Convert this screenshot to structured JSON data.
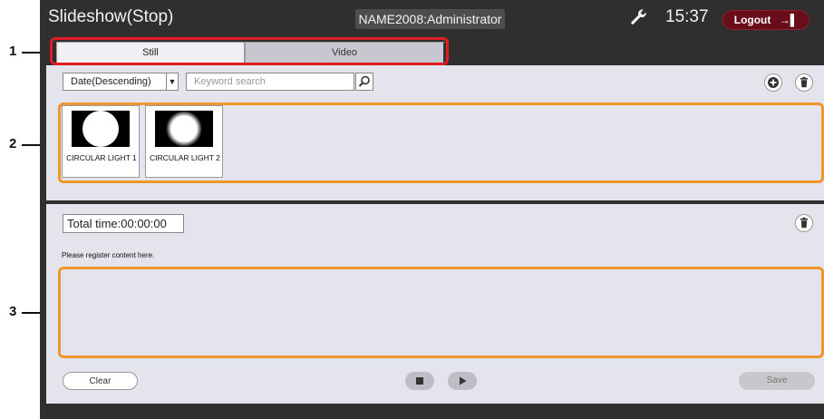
{
  "header": {
    "title": "Slideshow(Stop)",
    "user": "NAME2008:Administrator",
    "time": "15:37",
    "logout_label": "Logout",
    "settings_icon": "wrench-icon",
    "logout_icon": "exit-icon"
  },
  "tabs": [
    {
      "label": "Still",
      "selected": true
    },
    {
      "label": "Video",
      "selected": false
    }
  ],
  "toolbar": {
    "sort_value": "Date(Descending)",
    "search_placeholder": "Keyword search",
    "search_icon": "magnifier-icon",
    "add_icon": "add-icon",
    "delete_icon": "trash-icon"
  },
  "content_items": [
    {
      "label": "CIRCULAR LIGHT 1",
      "image": "white-circle"
    },
    {
      "label": "CIRCULAR LIGHT 2",
      "image": "blurred-circle"
    }
  ],
  "playlist": {
    "total_time": "Total time:00:00:00",
    "hint": "Please register content here.",
    "delete_icon": "trash-icon"
  },
  "controls": {
    "clear_label": "Clear",
    "save_label": "Save",
    "stop_icon": "stop-icon",
    "play_icon": "play-icon"
  },
  "callouts": [
    "1",
    "2",
    "3"
  ],
  "colors": {
    "frame": "#2f2f2f",
    "panel": "#e4e4ec",
    "logout": "#6a0d1a",
    "callout_red": "#e01b22",
    "callout_orange": "#f0962a"
  }
}
